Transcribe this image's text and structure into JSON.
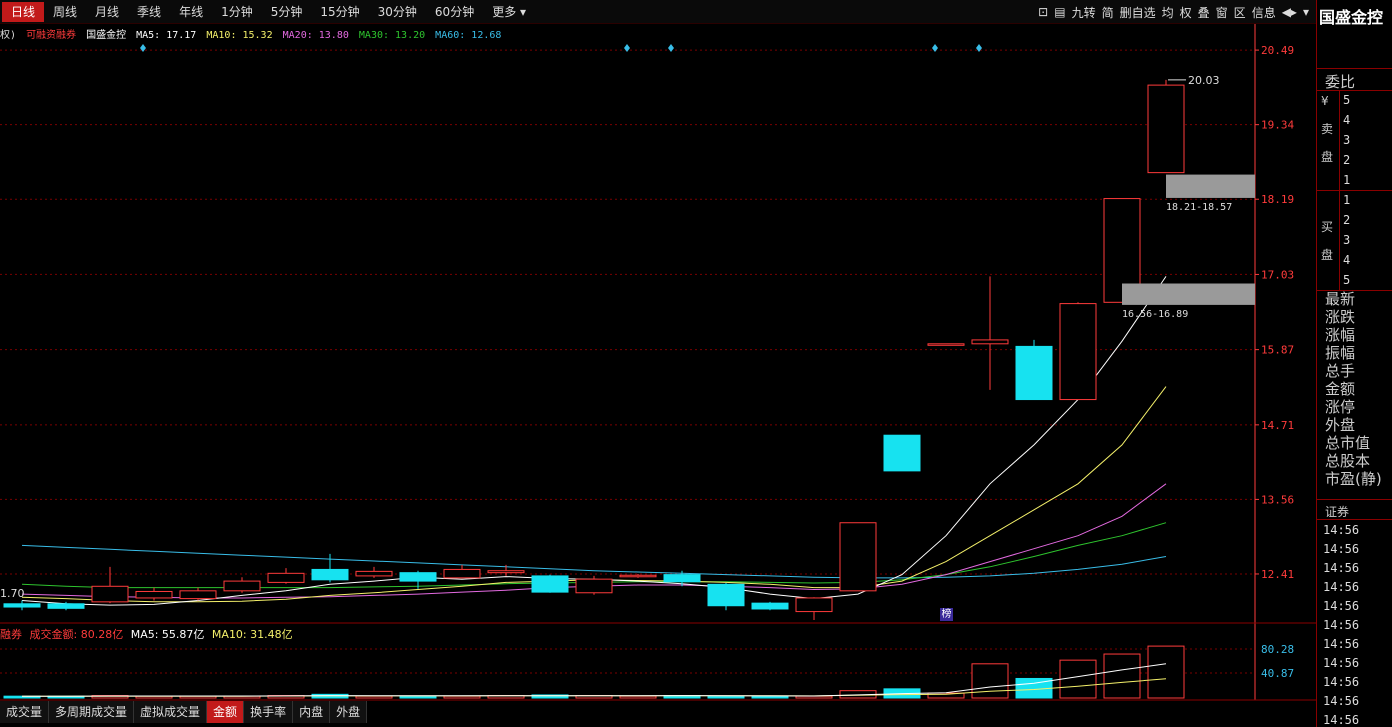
{
  "topbar": {
    "tabs": [
      "日线",
      "周线",
      "月线",
      "季线",
      "年线",
      "1分钟",
      "5分钟",
      "15分钟",
      "30分钟",
      "60分钟",
      "更多"
    ],
    "active_tab": "日线",
    "icons": [
      "⊡",
      "▤",
      "九转",
      "简",
      "删自选",
      "均",
      "权",
      "叠",
      "窗",
      "区",
      "信息",
      "◀▸",
      "▾"
    ]
  },
  "info": {
    "prefix": "权)",
    "tag": "可融资融券",
    "name": "国盛金控",
    "ma5": "MA5: 17.17",
    "ma10": "MA10: 15.32",
    "ma20": "MA20: 13.80",
    "ma30": "MA30: 13.20",
    "ma60": "MA60: 12.68"
  },
  "colors": {
    "up": "#ff3b3b",
    "down": "#17e2f0",
    "ma5": "#ffffff",
    "ma10": "#f4f06a",
    "ma20": "#e36ae0",
    "ma30": "#2ec42e",
    "ma60": "#39bde8",
    "axis": "#ff3b3b",
    "grid": "#7a0000"
  },
  "axis": {
    "price_ticks": [
      "20.49",
      "19.34",
      "18.19",
      "17.03",
      "15.87",
      "14.71",
      "13.56",
      "12.41"
    ],
    "vol_ticks": [
      "80.28",
      "40.87"
    ]
  },
  "annotations": {
    "high_label": "20.03",
    "low_label": "1.70",
    "sell_band_label": "18.21-18.57",
    "buy_band_label": "16.56-16.89",
    "bang": "榜"
  },
  "chart_data": {
    "type": "candlestick",
    "ylim": [
      11.7,
      20.8
    ],
    "candles": [
      {
        "o": 11.95,
        "h": 12.0,
        "l": 11.85,
        "c": 11.9
      },
      {
        "o": 11.95,
        "h": 11.98,
        "l": 11.85,
        "c": 11.88
      },
      {
        "o": 11.98,
        "h": 12.52,
        "l": 11.96,
        "c": 12.22
      },
      {
        "o": 12.04,
        "h": 12.2,
        "l": 12.0,
        "c": 12.14
      },
      {
        "o": 12.03,
        "h": 12.2,
        "l": 12.0,
        "c": 12.15
      },
      {
        "o": 12.15,
        "h": 12.36,
        "l": 12.12,
        "c": 12.3
      },
      {
        "o": 12.28,
        "h": 12.5,
        "l": 12.26,
        "c": 12.42
      },
      {
        "o": 12.48,
        "h": 12.72,
        "l": 12.28,
        "c": 12.32
      },
      {
        "o": 12.38,
        "h": 12.52,
        "l": 12.35,
        "c": 12.45
      },
      {
        "o": 12.43,
        "h": 12.46,
        "l": 12.18,
        "c": 12.3
      },
      {
        "o": 12.35,
        "h": 12.55,
        "l": 12.34,
        "c": 12.48
      },
      {
        "o": 12.43,
        "h": 12.55,
        "l": 12.38,
        "c": 12.46
      },
      {
        "o": 12.38,
        "h": 12.4,
        "l": 12.12,
        "c": 12.13
      },
      {
        "o": 12.12,
        "h": 12.38,
        "l": 12.09,
        "c": 12.33
      },
      {
        "o": 12.38,
        "h": 12.41,
        "l": 12.35,
        "c": 12.39
      },
      {
        "o": 12.4,
        "h": 12.46,
        "l": 12.22,
        "c": 12.29
      },
      {
        "o": 12.25,
        "h": 12.27,
        "l": 11.85,
        "c": 11.92
      },
      {
        "o": 11.96,
        "h": 11.98,
        "l": 11.85,
        "c": 11.87
      },
      {
        "o": 11.83,
        "h": 12.05,
        "l": 11.7,
        "c": 12.04
      },
      {
        "o": 12.15,
        "h": 13.2,
        "l": 12.15,
        "c": 13.2
      },
      {
        "o": 14.55,
        "h": 14.55,
        "l": 14.0,
        "c": 14.0
      },
      {
        "o": 15.95,
        "h": 15.95,
        "l": 15.95,
        "c": 15.96
      },
      {
        "o": 15.96,
        "h": 17.0,
        "l": 15.25,
        "c": 16.02
      },
      {
        "o": 15.92,
        "h": 16.02,
        "l": 15.1,
        "c": 15.1
      },
      {
        "o": 15.1,
        "h": 16.6,
        "l": 15.1,
        "c": 16.58
      },
      {
        "o": 16.6,
        "h": 18.2,
        "l": 16.6,
        "c": 18.2
      },
      {
        "o": 18.6,
        "h": 20.03,
        "l": 18.6,
        "c": 19.95
      }
    ],
    "ma5": [
      12.0,
      11.95,
      11.93,
      11.94,
      12.0,
      12.08,
      12.15,
      12.25,
      12.3,
      12.36,
      12.33,
      12.37,
      12.34,
      12.33,
      12.3,
      12.26,
      12.2,
      12.1,
      12.03,
      12.1,
      12.4,
      13.0,
      13.8,
      14.4,
      15.1,
      16.0,
      17.0
    ],
    "ma10": [
      12.05,
      12.03,
      12.0,
      11.98,
      11.98,
      11.99,
      12.02,
      12.08,
      12.12,
      12.17,
      12.22,
      12.28,
      12.3,
      12.32,
      12.31,
      12.3,
      12.28,
      12.25,
      12.2,
      12.2,
      12.3,
      12.6,
      13.0,
      13.4,
      13.8,
      14.4,
      15.3
    ],
    "ma20": [
      12.1,
      12.08,
      12.06,
      12.05,
      12.04,
      12.04,
      12.05,
      12.06,
      12.08,
      12.1,
      12.13,
      12.16,
      12.2,
      12.22,
      12.24,
      12.24,
      12.22,
      12.2,
      12.17,
      12.18,
      12.25,
      12.4,
      12.6,
      12.8,
      13.0,
      13.3,
      13.8
    ],
    "ma30": [
      12.25,
      12.22,
      12.2,
      12.2,
      12.2,
      12.2,
      12.2,
      12.2,
      12.21,
      12.22,
      12.24,
      12.26,
      12.27,
      12.28,
      12.29,
      12.29,
      12.29,
      12.28,
      12.27,
      12.28,
      12.32,
      12.4,
      12.52,
      12.68,
      12.85,
      13.0,
      13.2
    ],
    "ma60": [
      12.85,
      12.82,
      12.79,
      12.76,
      12.73,
      12.7,
      12.67,
      12.64,
      12.61,
      12.58,
      12.55,
      12.52,
      12.49,
      12.46,
      12.44,
      12.42,
      12.4,
      12.38,
      12.36,
      12.35,
      12.35,
      12.36,
      12.38,
      12.42,
      12.48,
      12.56,
      12.68
    ],
    "volume": [
      3,
      3,
      4,
      3,
      3,
      3,
      4,
      6,
      3,
      3,
      3,
      4,
      5,
      4,
      3,
      4,
      3,
      3,
      3,
      12,
      15,
      8,
      56,
      32,
      62,
      72,
      85
    ],
    "vol_ma5": [
      3,
      3,
      3.2,
      3.2,
      3.2,
      3.2,
      3.4,
      4,
      3.8,
      3.8,
      3.6,
      3.8,
      3.8,
      3.8,
      3.8,
      4,
      3.8,
      3.4,
      3.2,
      5,
      7.2,
      8.6,
      18,
      24,
      35,
      46,
      56
    ],
    "vol_ma10": [
      3,
      3,
      3,
      3,
      3,
      3,
      3.2,
      3.5,
      3.5,
      3.5,
      3.5,
      3.6,
      3.8,
      3.8,
      3.8,
      3.8,
      3.8,
      3.6,
      3.5,
      4.4,
      5.5,
      6.1,
      11.2,
      14,
      19.2,
      25.5,
      31.5
    ],
    "volume_unit": "亿",
    "volume_ylim": [
      0,
      95
    ],
    "diamond_markers": [
      3,
      14,
      15,
      21,
      22
    ]
  },
  "volinfo": {
    "prefix": "融券",
    "label": "成交金额: 80.28亿",
    "ma5": "MA5: 55.87亿",
    "ma10": "MA10: 31.48亿"
  },
  "bottom_tabs": [
    "成交量",
    "多周期成交量",
    "虚拟成交量",
    "金额",
    "换手率",
    "内盘",
    "外盘"
  ],
  "active_bottom": "金额",
  "sidebar": {
    "title": "国盛金控",
    "weibi": "委比",
    "yen": "¥",
    "sell_chars": [
      "卖",
      "盘"
    ],
    "buy_chars": [
      "买",
      "盘"
    ],
    "sell_levels": [
      "5",
      "4",
      "3",
      "2",
      "1"
    ],
    "buy_levels": [
      "1",
      "2",
      "3",
      "4",
      "5"
    ],
    "quote_labels": [
      "最新",
      "涨跌",
      "涨幅",
      "振幅",
      "总手",
      "金额",
      "涨停",
      "外盘",
      "总市值",
      "总股本",
      "市盈(静)"
    ],
    "zhengquan": "证券",
    "times": [
      "14:56",
      "14:56",
      "14:56",
      "14:56",
      "14:56",
      "14:56",
      "14:56",
      "14:56",
      "14:56",
      "14:56",
      "14:56"
    ]
  }
}
